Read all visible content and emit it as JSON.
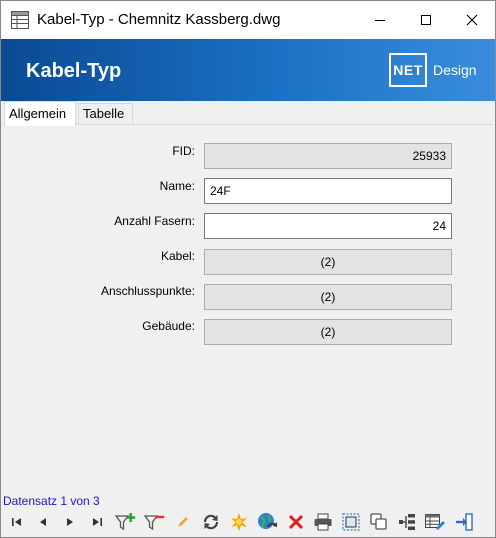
{
  "window": {
    "title": "Kabel-Typ - Chemnitz Kassberg.dwg"
  },
  "banner": {
    "title": "Kabel-Typ",
    "logo_mark": "NET",
    "logo_text": "Design"
  },
  "tabs": [
    {
      "label": "Allgemein",
      "active": true
    },
    {
      "label": "Tabelle",
      "active": false
    }
  ],
  "form": {
    "fields": [
      {
        "label": "FID:",
        "value": "25933",
        "editable": false,
        "align": "right"
      },
      {
        "label": "Name:",
        "value": "24F",
        "editable": true,
        "align": "left"
      },
      {
        "label": "Anzahl Fasern:",
        "value": "24",
        "editable": true,
        "align": "right"
      },
      {
        "label": "Kabel:",
        "value": "(2)",
        "editable": false,
        "align": "center"
      },
      {
        "label": "Anschlusspunkte:",
        "value": "(2)",
        "editable": false,
        "align": "center"
      },
      {
        "label": "Gebäude:",
        "value": "(2)",
        "editable": false,
        "align": "center"
      }
    ]
  },
  "status": {
    "record_text": "Datensatz 1 von 3"
  },
  "toolbar": {
    "buttons": [
      "first-record-icon",
      "previous-record-icon",
      "next-record-icon",
      "last-record-icon",
      "filter-add-icon",
      "filter-remove-icon",
      "edit-pencil-icon",
      "refresh-icon",
      "highlight-icon",
      "globe-refresh-icon",
      "delete-icon",
      "print-icon",
      "select-icon",
      "copy-icon",
      "tree-icon",
      "table-edit-icon",
      "exit-icon"
    ]
  },
  "colors": {
    "banner_start": "#0a4a93",
    "banner_end": "#3a8ddc",
    "status_text": "#1a1ac8"
  }
}
